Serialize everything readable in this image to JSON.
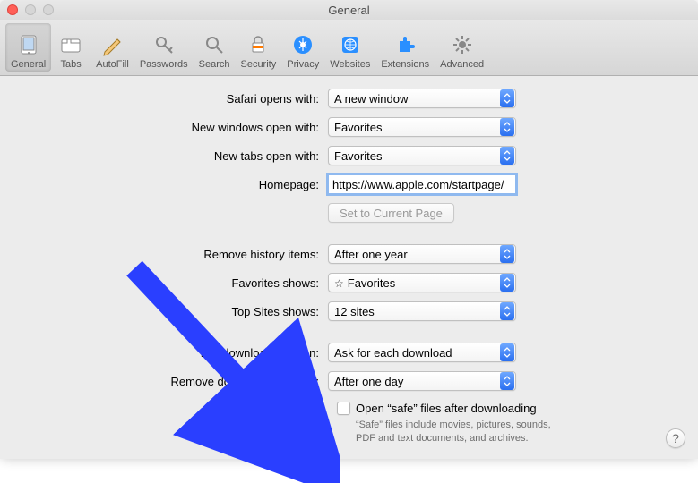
{
  "window": {
    "title": "General"
  },
  "toolbar": {
    "items": [
      {
        "label": "General"
      },
      {
        "label": "Tabs"
      },
      {
        "label": "AutoFill"
      },
      {
        "label": "Passwords"
      },
      {
        "label": "Search"
      },
      {
        "label": "Security"
      },
      {
        "label": "Privacy"
      },
      {
        "label": "Websites"
      },
      {
        "label": "Extensions"
      },
      {
        "label": "Advanced"
      }
    ]
  },
  "labels": {
    "opens_with": "Safari opens with:",
    "new_windows": "New windows open with:",
    "new_tabs": "New tabs open with:",
    "homepage": "Homepage:",
    "set_current": "Set to Current Page",
    "remove_history": "Remove history items:",
    "favorites_shows": "Favorites shows:",
    "topsites_shows": "Top Sites shows:",
    "download_location": "File download location:",
    "remove_downloads": "Remove download list items:"
  },
  "values": {
    "opens_with": "A new window",
    "new_windows": "Favorites",
    "new_tabs": "Favorites",
    "homepage": "https://www.apple.com/startpage/",
    "remove_history": "After one year",
    "favorites_shows": "Favorites",
    "topsites_shows": "12 sites",
    "download_location": "Ask for each download",
    "remove_downloads": "After one day"
  },
  "checkbox": {
    "label": "Open “safe” files after downloading",
    "hint": "“Safe” files include movies, pictures, sounds, PDF and text documents, and archives."
  },
  "help": "?"
}
